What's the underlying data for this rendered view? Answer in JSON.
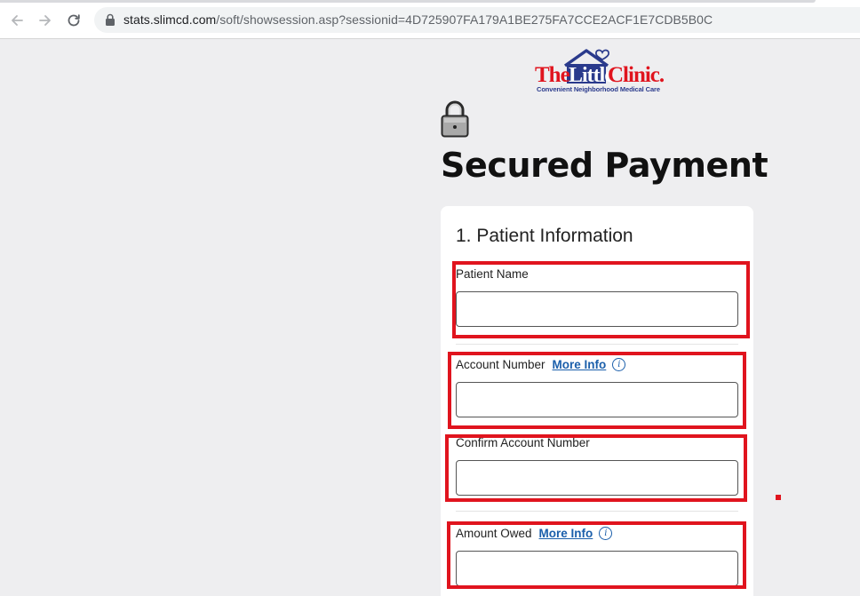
{
  "browser": {
    "url_host": "stats.slimcd.com",
    "url_path": "/soft/showsession.asp?sessionid=4D725907FA179A1BE275FA7CCE2ACF1E7CDB5B0C",
    "back_icon": "arrow-left-icon",
    "forward_icon": "arrow-right-icon",
    "reload_icon": "reload-icon",
    "lock_icon": "lock-icon"
  },
  "brand": {
    "logo_text": "TheLittleClinic.",
    "tagline": "Convenient Neighborhood Medical Care",
    "colors": {
      "red": "#e0141e",
      "blue": "#2a3a8c"
    }
  },
  "page": {
    "title": "Secured Payment",
    "lock_icon": "padlock-icon"
  },
  "form": {
    "section_title": "1. Patient Information",
    "fields": [
      {
        "label": "Patient Name",
        "value": ""
      },
      {
        "label": "Account Number",
        "more_info": "More Info",
        "value": ""
      },
      {
        "label": "Confirm Account Number",
        "value": ""
      },
      {
        "label": "Amount Owed",
        "more_info": "More Info",
        "value": ""
      }
    ]
  },
  "annotation": {
    "highlight_color": "#e0141e"
  }
}
